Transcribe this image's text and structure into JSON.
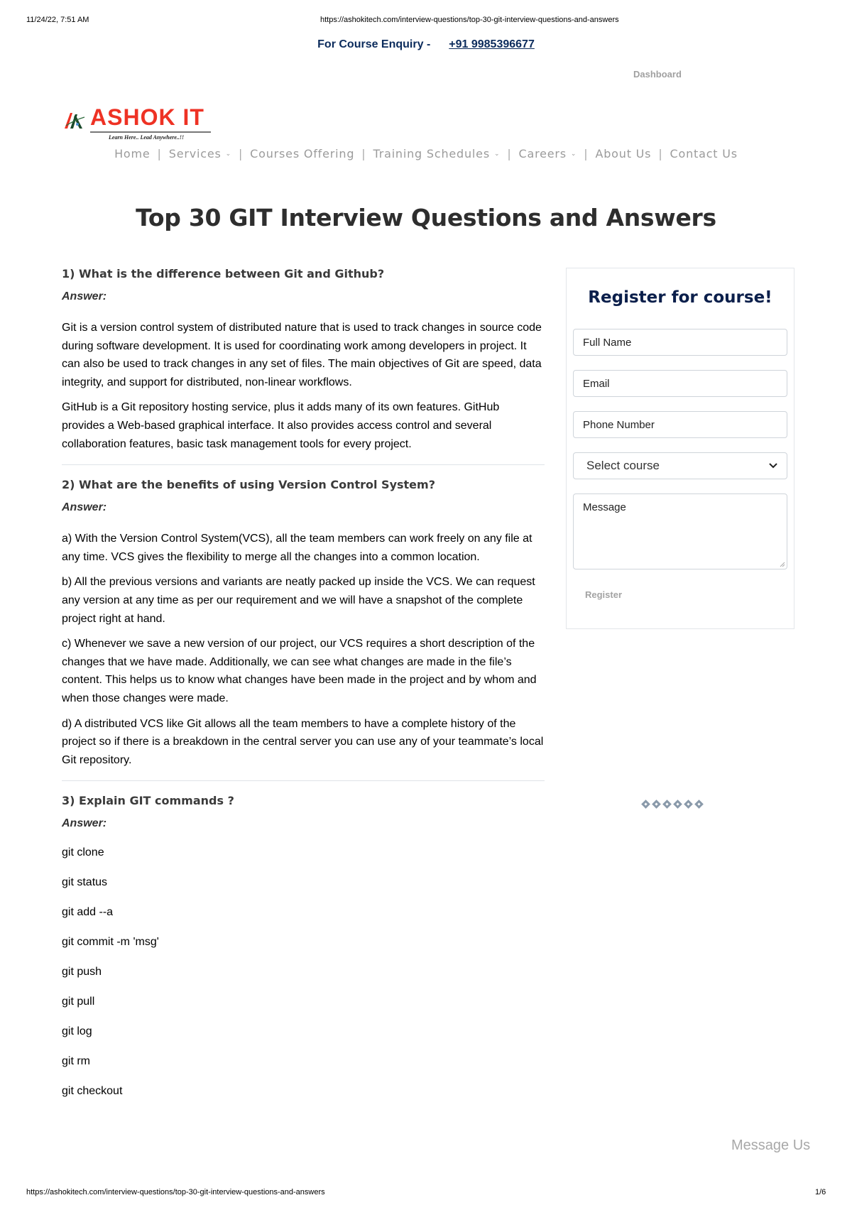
{
  "print": {
    "date": "11/24/22, 7:51 AM",
    "url": "https://ashokitech.com/interview-questions/top-30-git-interview-questions-and-answers",
    "page": "1/6"
  },
  "topbar": {
    "enquiry_label": "For Course Enquiry -",
    "phone": "+91 9985396677",
    "dashboard": "Dashboard"
  },
  "logo": {
    "name": "ASHOK IT",
    "tagline": "Learn Here.. Lead Anywhere..!!",
    "brand_color": "#ee3224"
  },
  "nav": {
    "items": [
      {
        "label": "Home",
        "dropdown": false
      },
      {
        "label": "Services",
        "dropdown": true
      },
      {
        "label": "Courses Offering",
        "dropdown": false
      },
      {
        "label": "Training Schedules",
        "dropdown": true
      },
      {
        "label": "Careers",
        "dropdown": true
      },
      {
        "label": "About Us",
        "dropdown": false
      },
      {
        "label": "Contact Us",
        "dropdown": false
      }
    ],
    "separator": "|",
    "chevron": "⌄"
  },
  "page": {
    "title": "Top 30 GIT Interview Questions and Answers"
  },
  "questions": [
    {
      "question": "1) What is the difference between Git and Github?",
      "answer_label": "Answer:",
      "paragraphs": [
        "Git is a version control system of distributed nature that is used to track changes in source code during software development. It is used for coordinating work among developers in project. It can also be used to track changes in any set of files. The main objectives of Git are speed, data integrity, and support for distributed, non-linear workflows.",
        "GitHub is a Git repository hosting service, plus it adds many of its own features. GitHub provides a Web-based graphical interface. It also provides access control and several collaboration features, basic task management tools for every project."
      ]
    },
    {
      "question": "2) What are the benefits of using Version Control System?",
      "answer_label": "Answer:",
      "paragraphs": [
        "a) With the Version Control System(VCS), all the team members can work freely on any file at any time. VCS gives  the flexibility to merge all the changes into a common location.",
        "b) All the previous versions and variants are neatly packed up inside the VCS. We can request any version at any time as per our requirement and we will have a snapshot of the complete project right at hand.",
        "c) Whenever we save a new version of our project, our VCS requires a short description of the changes that we have made. Additionally, we can see what changes are made in the file’s content. This helps us to know what changes have been made in the project and by whom and when those changes were made.",
        "d) A distributed VCS like Git allows all the team members to have a complete history of the project so if there is a breakdown in the central server you can use any of your teammate’s local Git repository."
      ]
    },
    {
      "question": "3) Explain GIT commands ?",
      "answer_label": "Answer:",
      "commands": [
        "git clone",
        "git status",
        "git add --a",
        "git commit -m 'msg'",
        "git push",
        "git pull",
        "git log",
        "git rm",
        "git checkout"
      ]
    }
  ],
  "sidebar": {
    "title": "Register for course!",
    "fields": {
      "full_name_placeholder": "Full Name",
      "email_placeholder": "Email",
      "phone_placeholder": "Phone Number",
      "course_selected": "Select course",
      "message_placeholder": "Message"
    },
    "register_label": "Register",
    "title_color": "#0b1f4b"
  },
  "loader": {
    "icon": "diamond-loader-icon",
    "count": 6
  },
  "chat": {
    "label": "Message Us"
  }
}
